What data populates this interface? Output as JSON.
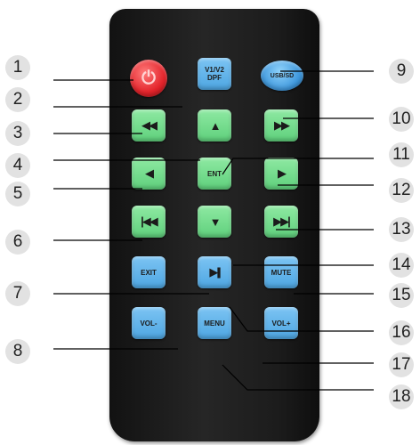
{
  "callouts": [
    "1",
    "2",
    "3",
    "4",
    "5",
    "6",
    "7",
    "8",
    "9",
    "10",
    "11",
    "12",
    "13",
    "14",
    "15",
    "16",
    "17",
    "18"
  ],
  "buttons": {
    "power": {
      "icon": "power-icon",
      "glyph": "⏻"
    },
    "v1v2_dpf": {
      "label": "V1/V2\nDPF"
    },
    "usb_sd": {
      "label": "USB/SD"
    },
    "rewind": {
      "icon": "rewind-icon",
      "glyph": "◀◀"
    },
    "up": {
      "icon": "arrow-up-icon",
      "glyph": "▲"
    },
    "fast_forward": {
      "icon": "fast-forward-icon",
      "glyph": "▶▶"
    },
    "left": {
      "icon": "arrow-left-icon",
      "glyph": "◀"
    },
    "enter": {
      "label": "ENT"
    },
    "right": {
      "icon": "arrow-right-icon",
      "glyph": "▶"
    },
    "previous": {
      "icon": "previous-track-icon",
      "glyph": "|◀◀"
    },
    "down": {
      "icon": "arrow-down-icon",
      "glyph": "▼"
    },
    "next": {
      "icon": "next-track-icon",
      "glyph": "▶▶|"
    },
    "exit": {
      "label": "EXIT"
    },
    "play_pause": {
      "icon": "play-pause-icon",
      "glyph": "▶||"
    },
    "mute": {
      "label": "MUTE"
    },
    "vol_down": {
      "label": "VOL-"
    },
    "menu": {
      "label": "MENU"
    },
    "vol_up": {
      "label": "VOL+"
    }
  },
  "colors": {
    "body": "#1e1e1e",
    "power": "#e3242b",
    "nav_keys": "#6edc8a",
    "function_keys": "#5ab0ea",
    "callout_circle": "#e2e2e2",
    "leader_line": "#000000"
  }
}
